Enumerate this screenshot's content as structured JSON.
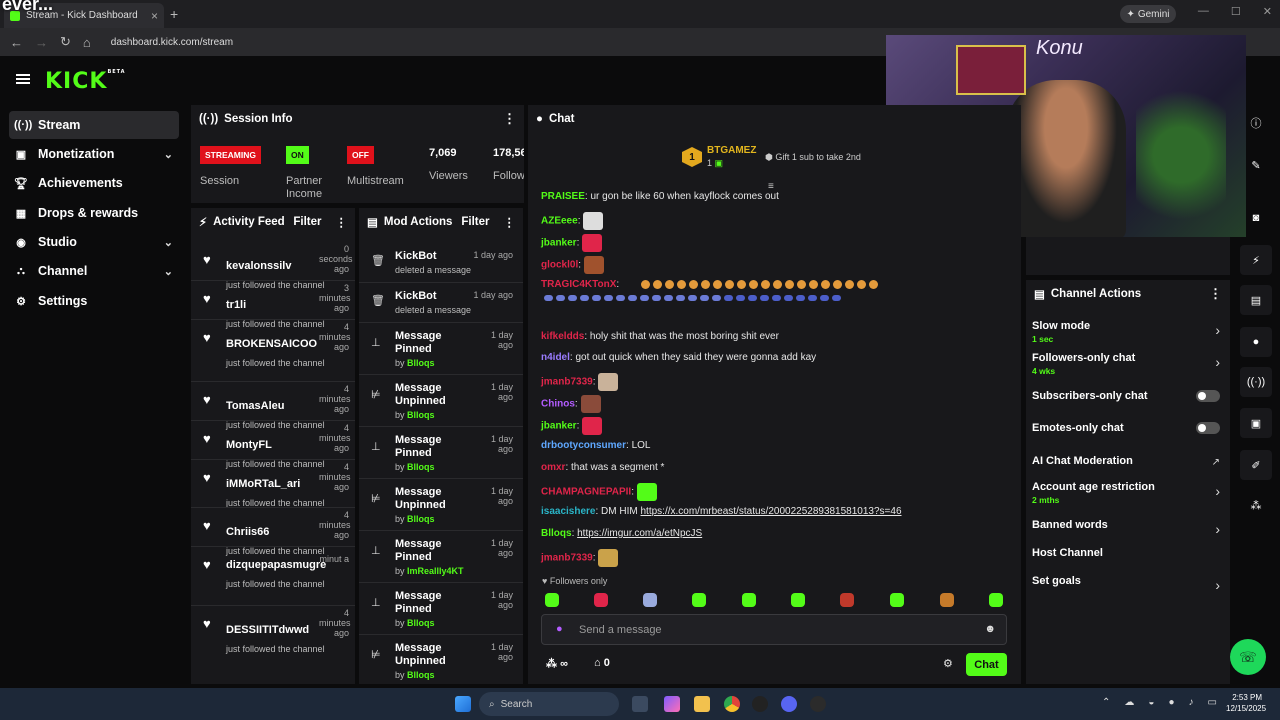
{
  "browser": {
    "overlay_text": "ever...",
    "tab_title": "Stream - Kick Dashboard",
    "url": "dashboard.kick.com/stream",
    "gemini_label": "Gemini"
  },
  "header": {
    "logo": "KICK",
    "logo_sup": "BETA"
  },
  "sidebar": {
    "items": [
      {
        "label": "Stream",
        "icon": "broadcast-icon"
      },
      {
        "label": "Monetization",
        "icon": "money-icon"
      },
      {
        "label": "Achievements",
        "icon": "trophy-icon"
      },
      {
        "label": "Drops & rewards",
        "icon": "gift-icon"
      },
      {
        "label": "Studio",
        "icon": "studio-icon"
      },
      {
        "label": "Channel",
        "icon": "channel-icon"
      },
      {
        "label": "Settings",
        "icon": "gear-icon"
      }
    ]
  },
  "session": {
    "title": "Session Info",
    "streaming_badge": "STREAMING",
    "on_badge": "ON",
    "off_badge": "OFF",
    "session_label": "Session",
    "partner_label": "Partner Income",
    "multistream_label": "Multistream",
    "viewers_value": "7,069",
    "viewers_label": "Viewers",
    "followers_value": "178,56",
    "followers_label": "Follow"
  },
  "activity": {
    "title": "Activity Feed",
    "filter": "Filter",
    "items": [
      {
        "name": "kevalonssilv",
        "time": "0 seconds ago",
        "sub": "just followed the channel"
      },
      {
        "name": "tr1li",
        "time": "3 minutes ago",
        "sub": "just followed the channel"
      },
      {
        "name": "BROKENSAICOO",
        "time": "4 minutes ago",
        "sub": "just followed the channel"
      },
      {
        "name": "TomasAleu",
        "time": "4 minutes ago",
        "sub": "just followed the channel"
      },
      {
        "name": "MontyFL",
        "time": "4 minutes ago",
        "sub": "just followed the channel"
      },
      {
        "name": "iMMoRTaL_ari",
        "time": "4 minutes ago",
        "sub": "just followed the channel"
      },
      {
        "name": "Chriis66",
        "time": "4 minutes ago",
        "sub": "just followed the channel"
      },
      {
        "name": "dizquepapasmugre",
        "time": "minut a",
        "sub": "just followed the channel"
      },
      {
        "name": "DESSIITITdwwd",
        "time": "4 minutes ago",
        "sub": "just followed the channel"
      }
    ]
  },
  "mod": {
    "title": "Mod Actions",
    "filter": "Filter",
    "items": [
      {
        "action": "KickBot",
        "time": "1 day ago",
        "by": "deleted a message",
        "byname": ""
      },
      {
        "action": "KickBot",
        "time": "1 day ago",
        "by": "deleted a message",
        "byname": ""
      },
      {
        "action": "Message Pinned",
        "time": "1 day ago",
        "by": "by ",
        "byname": "Blloqs"
      },
      {
        "action": "Message Unpinned",
        "time": "1 day ago",
        "by": "by ",
        "byname": "Blloqs"
      },
      {
        "action": "Message Pinned",
        "time": "1 day ago",
        "by": "by ",
        "byname": "Blloqs"
      },
      {
        "action": "Message Unpinned",
        "time": "1 day ago",
        "by": "by ",
        "byname": "Blloqs"
      },
      {
        "action": "Message Pinned",
        "time": "1 day ago",
        "by": "by ",
        "byname": "ImReallly4KT"
      },
      {
        "action": "Message Pinned",
        "time": "1 day ago",
        "by": "by ",
        "byname": "Blloqs"
      },
      {
        "action": "Message Unpinned",
        "time": "1 day ago",
        "by": "by ",
        "byname": "Blloqs"
      }
    ]
  },
  "chat": {
    "title": "Chat",
    "leader_name": "BTGAMEZ",
    "leader_rank": "1",
    "leader_count": "1",
    "gift_text": "Gift 1 sub to take 2nd",
    "messages": [
      {
        "user": "PRAISEE",
        "color": "#53fc18",
        "text": ": ur gon be like 60 when kayflock comes out"
      },
      {
        "user": "AZEeee",
        "color": "#53fc18",
        "text": ":"
      },
      {
        "user": "jbanker",
        "color": "#53fc18",
        "text": ":"
      },
      {
        "user": "glockl0l",
        "color": "#e0254a",
        "text": ":"
      },
      {
        "user": "TRAGIC4KTonX",
        "color": "#e0254a",
        "text": ":"
      },
      {
        "user": "kifkeldds",
        "color": "#e0254a",
        "text": ": holy shit that was the most boring shit ever"
      },
      {
        "user": "n4idel",
        "color": "#9a7cff",
        "text": ": got out quick when they said they were gonna add kay"
      },
      {
        "user": "jmanb7339",
        "color": "#e0254a",
        "text": ":"
      },
      {
        "user": "Chinos",
        "color": "#b35cff",
        "text": ":"
      },
      {
        "user": "jbanker",
        "color": "#53fc18",
        "text": ":"
      },
      {
        "user": "drbootyconsumer",
        "color": "#5fa8ff",
        "text": ": LOL"
      },
      {
        "user": "omxr",
        "color": "#e0254a",
        "text": ": that was a segment *"
      },
      {
        "user": "CHAMPAGNEPAPII",
        "color": "#e0254a",
        "text": ":"
      },
      {
        "user": "isaacishere",
        "color": "#2ab5c8",
        "text": ": DM HIM ",
        "link": "https://x.com/mrbeast/status/2000225289381581013?s=46"
      },
      {
        "user": "Blloqs",
        "color": "#53fc18",
        "text": ": ",
        "link": "https://imgur.com/a/etNpcJS"
      },
      {
        "user": "jmanb7339",
        "color": "#e0254a",
        "text": ":"
      }
    ],
    "followers_only": "Followers only",
    "input_placeholder": "Send a message",
    "points": "∞",
    "count": "0",
    "send_label": "Chat"
  },
  "channel_actions": {
    "title": "Channel Actions",
    "rows": [
      {
        "label": "Slow mode",
        "sub": "1 sec",
        "kind": "chevron"
      },
      {
        "label": "Followers-only chat",
        "sub": "4 wks",
        "kind": "chevron"
      },
      {
        "label": "Subscribers-only chat",
        "sub": "",
        "kind": "toggle"
      },
      {
        "label": "Emotes-only chat",
        "sub": "",
        "kind": "toggle"
      },
      {
        "label": "AI Chat Moderation",
        "sub": "",
        "kind": "external"
      },
      {
        "label": "Account age restriction",
        "sub": "2 mths",
        "kind": "chevron"
      },
      {
        "label": "Banned words",
        "sub": "",
        "kind": "chevron"
      },
      {
        "label": "Host Channel",
        "sub": "",
        "kind": "none"
      },
      {
        "label": "Set goals",
        "sub": "",
        "kind": "chevron"
      }
    ]
  },
  "taskbar": {
    "search": "Search",
    "time": "2:53 PM",
    "date": "12/15/2025"
  },
  "colors": {
    "accent": "#53fc18",
    "streaming": "#e0111b",
    "panel": "#18181b"
  }
}
